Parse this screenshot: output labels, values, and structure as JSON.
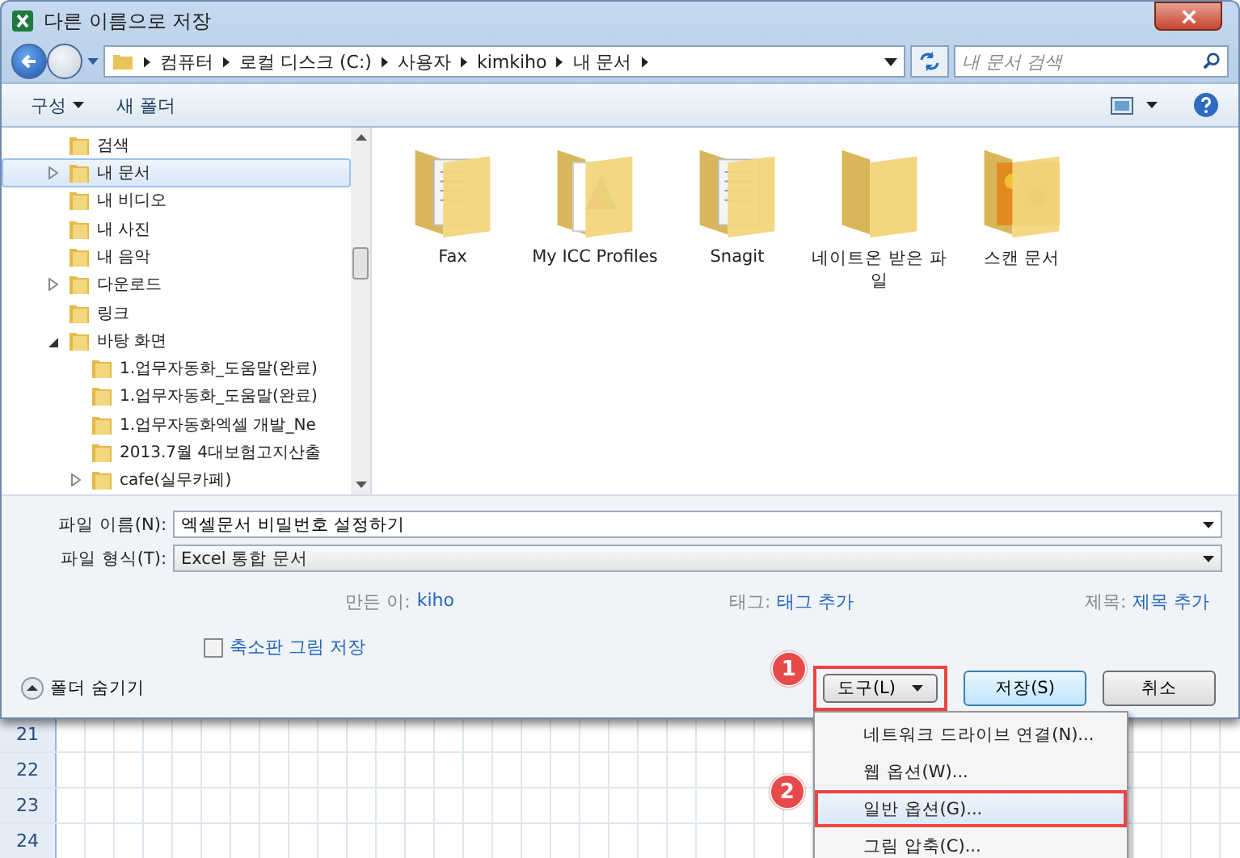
{
  "window": {
    "title": "다른 이름으로 저장"
  },
  "address_bar": {
    "path": [
      "컴퓨터",
      "로컬 디스크 (C:)",
      "사용자",
      "kimkiho",
      "내 문서"
    ]
  },
  "search": {
    "placeholder": "내 문서 검색"
  },
  "toolbar": {
    "buttons": [
      "구성",
      "새 폴더"
    ]
  },
  "nav_tree": [
    {
      "label": "검색",
      "selected": false,
      "kind": "leaf"
    },
    {
      "label": "내 문서",
      "selected": true,
      "kind": "collapsed"
    },
    {
      "label": "내 비디오",
      "selected": false,
      "kind": "leaf"
    },
    {
      "label": "내 사진",
      "selected": false,
      "kind": "leaf"
    },
    {
      "label": "내 음악",
      "selected": false,
      "kind": "leaf"
    },
    {
      "label": "다운로드",
      "selected": false,
      "kind": "collapsed"
    },
    {
      "label": "링크",
      "selected": false,
      "kind": "leaf"
    },
    {
      "label": "바탕 화면",
      "selected": false,
      "kind": "expanded",
      "children": [
        {
          "label": "1.업무자동화_도움말(완료)",
          "selected": false,
          "kind": "leaf"
        },
        {
          "label": "1.업무자동화_도움말(완료)",
          "selected": false,
          "kind": "leaf"
        },
        {
          "label": "1.업무자동화엑셀 개발_Ne",
          "selected": false,
          "kind": "leaf"
        },
        {
          "label": "2013.7월 4대보험고지산출",
          "selected": false,
          "kind": "leaf"
        },
        {
          "label": "cafe(실무카페)",
          "selected": false,
          "kind": "collapsed"
        }
      ]
    }
  ],
  "files": [
    {
      "name": "Fax",
      "kind": "documents"
    },
    {
      "name": "My ICC Profiles",
      "kind": "color-profile"
    },
    {
      "name": "Snagit",
      "kind": "documents"
    },
    {
      "name": "네이트온 받은 파일",
      "kind": "empty"
    },
    {
      "name": "스캔 문서",
      "kind": "photo"
    }
  ],
  "form": {
    "file_name_label": "파일 이름(N):",
    "file_name": "엑셀문서 비밀번호 설정하기",
    "file_type_label": "파일 형식(T):",
    "file_type": "Excel 통합 문서",
    "meta": [
      {
        "label": "만든 이:",
        "value": "kiho"
      },
      {
        "label": "태그:",
        "value": "태그 추가"
      },
      {
        "label": "제목:",
        "value": "제목 추가"
      }
    ],
    "thumbnail": {
      "label": "축소판 그림 저장",
      "checked": false
    }
  },
  "hide_folders": "폴더 숨기기",
  "buttons": {
    "tools": "도구(L)",
    "save": "저장(S)",
    "cancel": "취소"
  },
  "tools_menu": [
    {
      "label": "네트워크 드라이브 연결(N)...",
      "selected": false
    },
    {
      "label": "웹 옵션(W)...",
      "selected": false
    },
    {
      "label": "일반 옵션(G)...",
      "selected": true
    },
    {
      "label": "그림 압축(C)...",
      "selected": false
    }
  ],
  "callouts": [
    "1",
    "2"
  ],
  "sheet_rows": [
    "21",
    "22",
    "23",
    "24"
  ]
}
